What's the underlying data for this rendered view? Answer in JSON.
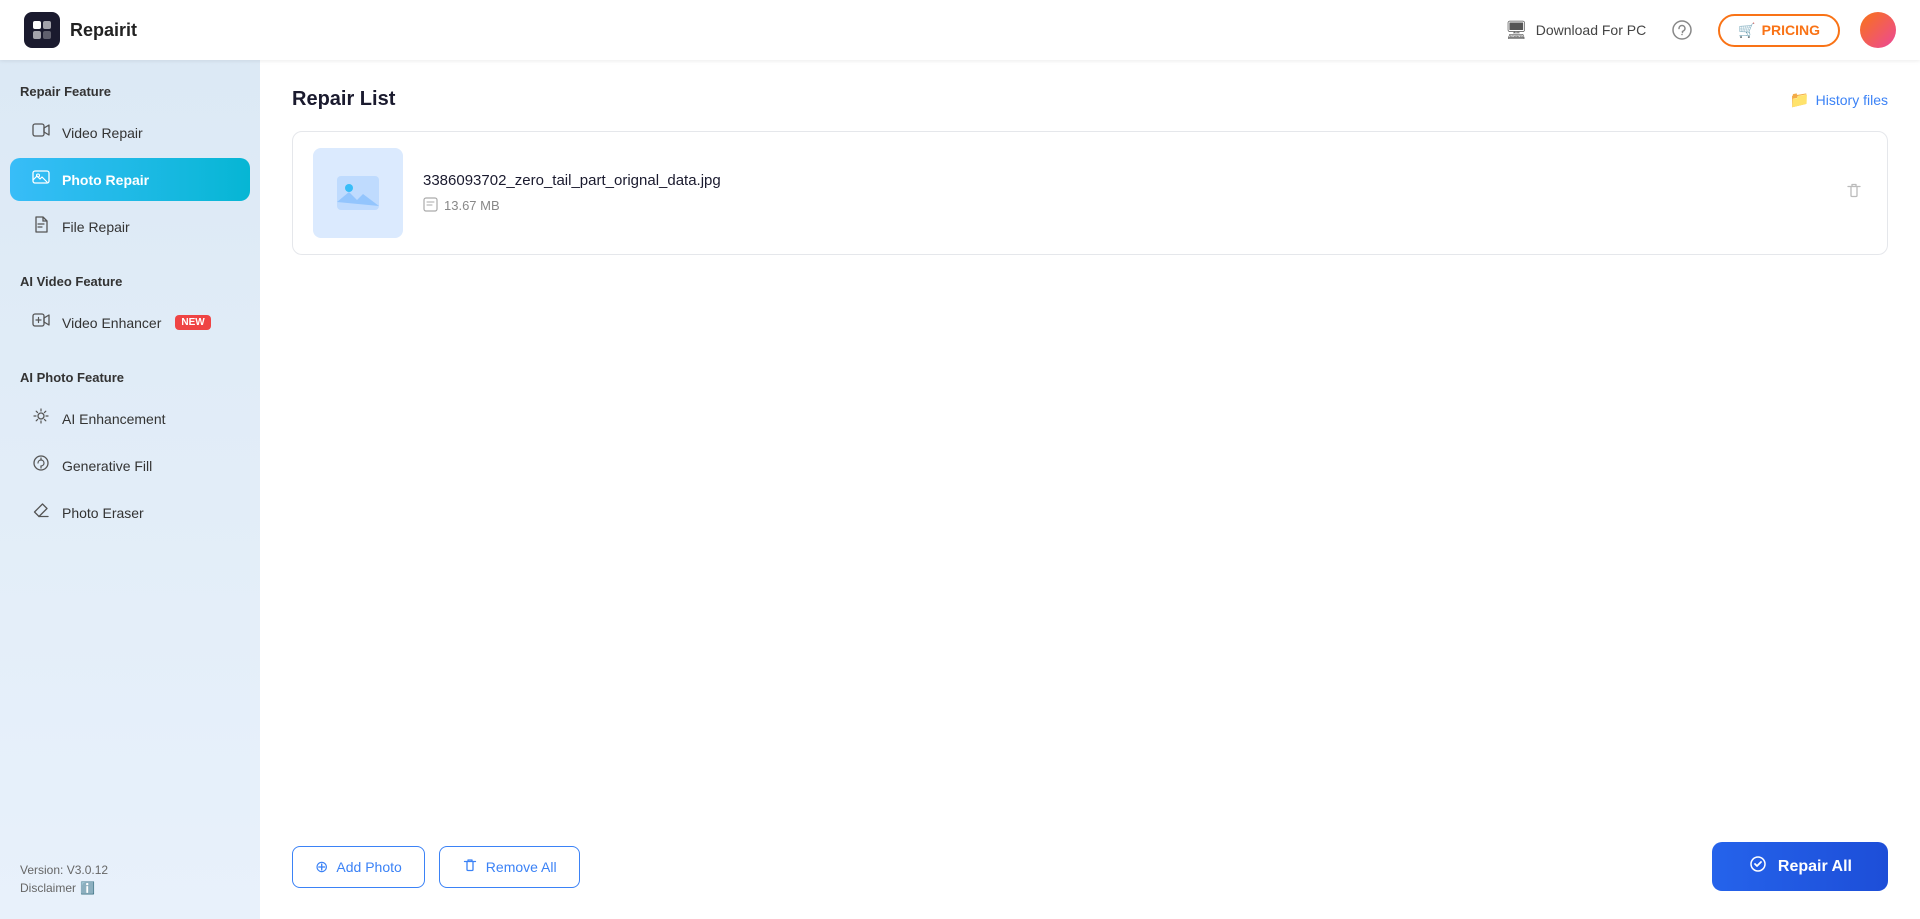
{
  "header": {
    "logo_text": "Repairit",
    "download_label": "Download For PC",
    "pricing_label": "PRICING",
    "logo_symbol": "⊞"
  },
  "sidebar": {
    "section1_label": "Repair Feature",
    "section2_label": "AI Video Feature",
    "section3_label": "AI Photo Feature",
    "items": [
      {
        "id": "video-repair",
        "label": "Video Repair",
        "active": false
      },
      {
        "id": "photo-repair",
        "label": "Photo Repair",
        "active": true
      },
      {
        "id": "file-repair",
        "label": "File Repair",
        "active": false
      },
      {
        "id": "video-enhancer",
        "label": "Video Enhancer",
        "active": false,
        "badge": "NEW"
      },
      {
        "id": "ai-enhancement",
        "label": "AI Enhancement",
        "active": false
      },
      {
        "id": "generative-fill",
        "label": "Generative Fill",
        "active": false
      },
      {
        "id": "photo-eraser",
        "label": "Photo Eraser",
        "active": false
      }
    ],
    "version_label": "Version: V3.0.12",
    "disclaimer_label": "Disclaimer"
  },
  "content": {
    "title": "Repair List",
    "history_files_label": "History files",
    "file": {
      "name": "3386093702_zero_tail_part_orignal_data.jpg",
      "size": "13.67 MB"
    },
    "add_photo_label": "Add Photo",
    "remove_all_label": "Remove All",
    "repair_all_label": "Repair All"
  }
}
